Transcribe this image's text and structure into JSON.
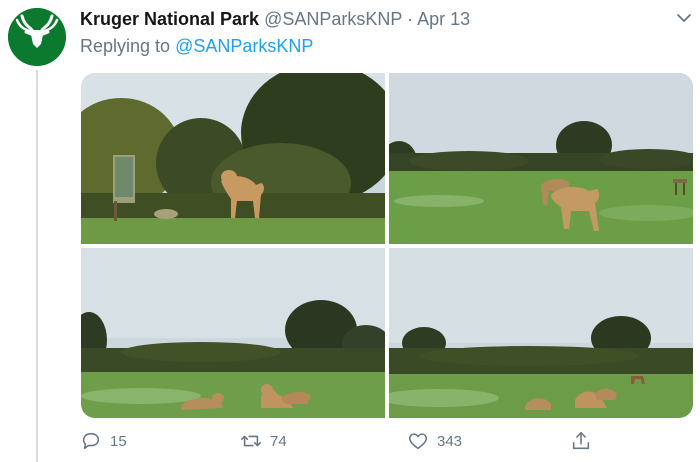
{
  "tweet": {
    "author_name": "Kruger National Park",
    "handle": "@SANParksKNP",
    "separator": "·",
    "date": "Apr 13",
    "replying_prefix": "Replying to",
    "replying_to": "@SANParksKNP",
    "avatar_icon": "sanparks-kudu-logo",
    "avatar_color": "#0b7a2e",
    "photos": [
      {
        "label": "lion-standing-by-sign"
      },
      {
        "label": "two-lions-walking-on-fairway"
      },
      {
        "label": "lions-lying-on-grass"
      },
      {
        "label": "lions-resting-with-antelope"
      }
    ],
    "actions": {
      "reply_count": "15",
      "retweet_count": "74",
      "like_count": "343"
    }
  }
}
